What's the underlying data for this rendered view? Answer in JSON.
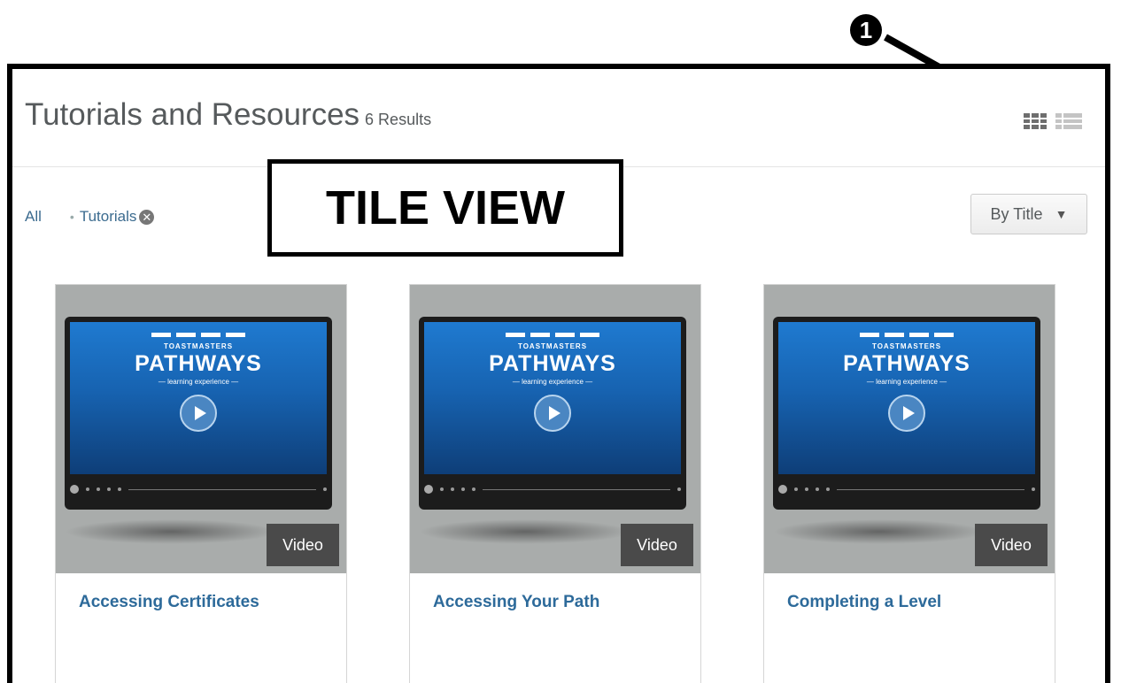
{
  "callout": {
    "number": "1"
  },
  "page": {
    "title": "Tutorials and Resources",
    "results": "6 Results"
  },
  "view_toggle": {
    "tile_icon": "grid-icon",
    "list_icon": "list-icon",
    "active": "tile"
  },
  "filters": {
    "all_label": "All",
    "active_tag": "Tutorials",
    "remove_icon": "close-circle-icon"
  },
  "annotation": {
    "label": "TILE VIEW"
  },
  "sort": {
    "label": "By Title",
    "caret_icon": "caret-down-icon"
  },
  "thumbnail": {
    "brand_top": "TOASTMASTERS",
    "brand_main": "PATHWAYS",
    "brand_sub": "— learning experience —",
    "play_icon": "play-icon"
  },
  "cards": [
    {
      "title": "Accessing Certificates",
      "badge": "Video"
    },
    {
      "title": "Accessing Your Path",
      "badge": "Video"
    },
    {
      "title": "Completing a Level",
      "badge": "Video"
    }
  ],
  "colors": {
    "link": "#2d6a9a",
    "title_text": "#565a5c",
    "badge_bg": "#4a4a4a"
  }
}
